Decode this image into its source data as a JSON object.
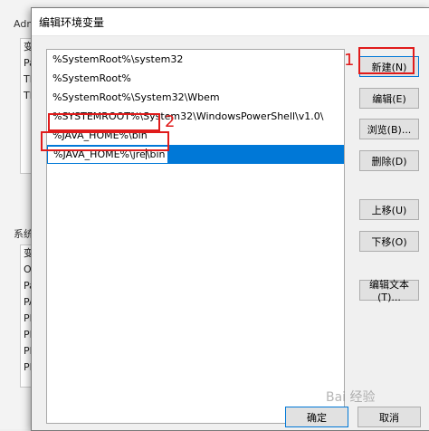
{
  "background": {
    "group1_label": "Adm",
    "group1_rows": [
      "变",
      "Pa",
      "TE",
      "TM"
    ],
    "group2_label": "系统",
    "group2_rows": [
      "变",
      "O",
      "Pa",
      "PA",
      "PF",
      "PF",
      "PF",
      "PF"
    ]
  },
  "dialog": {
    "title": "编辑环境变量",
    "paths": [
      "%SystemRoot%\\system32",
      "%SystemRoot%",
      "%SystemRoot%\\System32\\Wbem",
      "%SYSTEMROOT%\\System32\\WindowsPowerShell\\v1.0\\",
      "%JAVA_HOME%\\bin",
      "%JAVA_HOME%\\jre\\bin"
    ],
    "editing_before_caret": "%JAVA_HOME%\\jre",
    "editing_after_caret": "\\bin",
    "buttons": {
      "new": "新建(N)",
      "edit": "编辑(E)",
      "browse": "浏览(B)...",
      "delete": "删除(D)",
      "move_up": "上移(U)",
      "move_down": "下移(O)",
      "edit_text": "编辑文本(T)...",
      "ok": "确定",
      "cancel": "取消"
    }
  },
  "annotations": {
    "label1": "1",
    "label2": "2"
  },
  "watermark": "Bai 经验"
}
